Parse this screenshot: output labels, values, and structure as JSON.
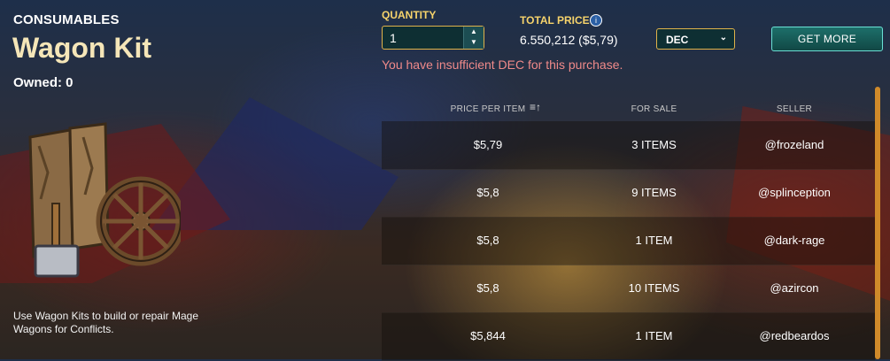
{
  "item": {
    "category": "CONSUMABLES",
    "name": "Wagon Kit",
    "owned": "Owned: 0",
    "description": "Use Wagon Kits to build or repair Mage Wagons for Conflicts."
  },
  "purchase": {
    "quantity_label": "QUANTITY",
    "quantity_value": "1",
    "total_label": "TOTAL PRICE",
    "total_value": "6.550,212 ($5,79)",
    "currency": "DEC",
    "get_more_label": "GET MORE",
    "error": "You have insufficient DEC for this purchase."
  },
  "table": {
    "headers": {
      "price": "PRICE PER ITEM",
      "for_sale": "FOR SALE",
      "seller": "SELLER"
    },
    "rows": [
      {
        "price": "$5,79",
        "for_sale": "3 ITEMS",
        "seller": "@frozeland"
      },
      {
        "price": "$5,8",
        "for_sale": "9 ITEMS",
        "seller": "@splinception"
      },
      {
        "price": "$5,8",
        "for_sale": "1 ITEM",
        "seller": "@dark-rage"
      },
      {
        "price": "$5,8",
        "for_sale": "10 ITEMS",
        "seller": "@azircon"
      },
      {
        "price": "$5,844",
        "for_sale": "1 ITEM",
        "seller": "@redbeardos"
      }
    ]
  },
  "icons": [
    "info-icon",
    "sort-icon",
    "spin-up-icon",
    "spin-down-icon",
    "chevron-down-icon",
    "wagon-kit-icon"
  ],
  "colors": {
    "gold": "#f6d36b",
    "teal": "#1d6f6a",
    "error": "#f08a8a",
    "scroll": "#d08a2a"
  }
}
